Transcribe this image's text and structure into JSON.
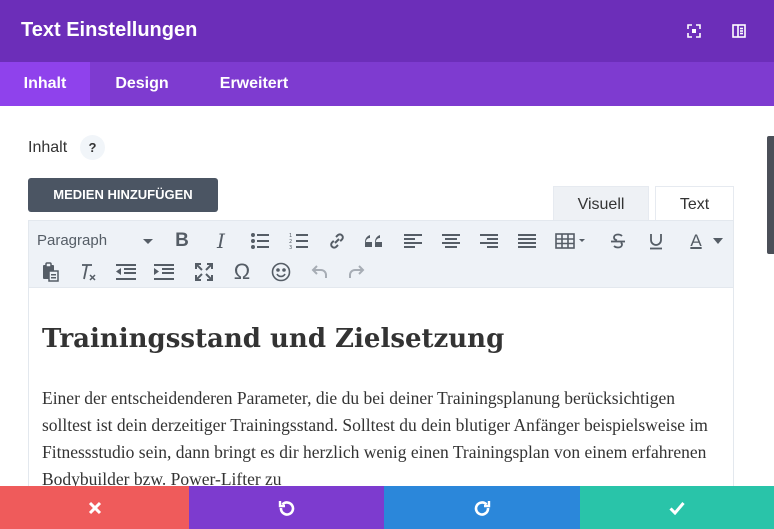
{
  "header": {
    "title": "Text Einstellungen",
    "icons": [
      "fullscreen-icon",
      "sidebar-layout-icon"
    ],
    "bg_color": "#6c2eb9"
  },
  "tabs": [
    {
      "label": "Inhalt",
      "active": true
    },
    {
      "label": "Design",
      "active": false
    },
    {
      "label": "Erweitert",
      "active": false
    }
  ],
  "content_field": {
    "label": "Inhalt",
    "help_label": "?"
  },
  "media_button": {
    "label": "MEDIEN HINZUFÜGEN"
  },
  "editor_modes": {
    "visual": "Visuell",
    "text": "Text",
    "active": "visual"
  },
  "toolbar": {
    "format_select": "Paragraph",
    "row1": [
      "bold-icon",
      "italic-icon",
      "bullet-list-icon",
      "numbered-list-icon",
      "link-icon",
      "blockquote-icon",
      "align-left-icon",
      "align-center-icon",
      "align-right-icon",
      "justify-icon",
      "table-icon",
      "strikethrough-icon",
      "underline-icon",
      "text-color-icon"
    ],
    "row2": [
      "paste-text-icon",
      "clear-formatting-icon",
      "outdent-icon",
      "indent-icon",
      "fullscreen-icon",
      "special-character-icon",
      "emoji-icon",
      "undo-icon",
      "redo-icon"
    ],
    "glyphs": {
      "bold": "B",
      "italic": "I",
      "omega": "Ω",
      "text_color": "A"
    }
  },
  "editor": {
    "heading": "Trainingsstand und Zielsetzung",
    "paragraph": "Einer der entscheidenderen Parameter, die du bei deiner Trainingsplanung berücksichtigen solltest ist dein derzeitiger Trainingsstand. Solltest du dein blutiger Anfänger beispielsweise im Fitnessstudio sein, dann bringt es dir herzlich wenig einen Trainingsplan von einem erfahrenen Bodybuilder bzw. Power-Lifter zu"
  },
  "footer": {
    "buttons": [
      {
        "name": "cancel",
        "icon": "close-icon",
        "color": "#ef5b5b"
      },
      {
        "name": "undo",
        "icon": "undo-icon",
        "color": "#7d3bcf"
      },
      {
        "name": "redo",
        "icon": "redo-icon",
        "color": "#2b87da"
      },
      {
        "name": "save",
        "icon": "check-icon",
        "color": "#29c4a9"
      }
    ]
  }
}
